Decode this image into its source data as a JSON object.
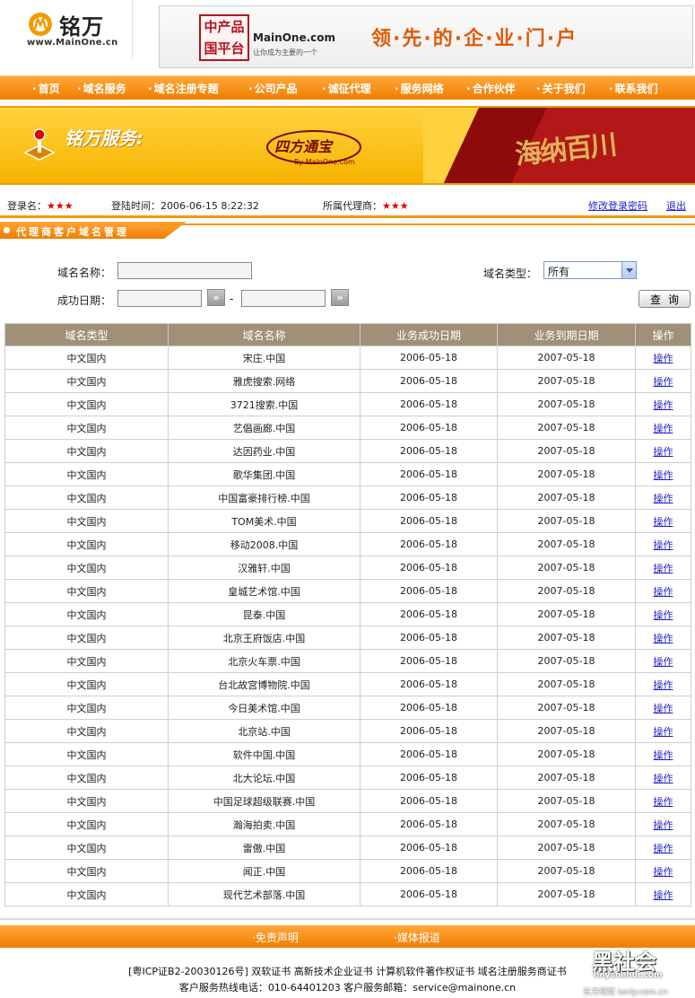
{
  "header": {
    "logo_text": "铭万",
    "logo_site": "www.MainOne.cn",
    "banner_seal": "中产品国平台",
    "banner_brand": "MainOne.com",
    "banner_sub": "让你成为主要的一个",
    "banner_slogan": "领·先·的·企·业·门·户"
  },
  "nav": {
    "items": [
      "首页",
      "域名服务",
      "域名注册专题",
      "公司产品",
      "诚征代理",
      "服务网络",
      "合作伙伴",
      "关于我们",
      "联系我们"
    ]
  },
  "service_banner": {
    "title": "铭万服务:",
    "product_name": "四方通宝",
    "product_byline": "By MainOne.com",
    "promo_text": "海纳百川"
  },
  "info": {
    "login_label": "登录名：",
    "login_value": "★★★",
    "time_label": "登陆时间：",
    "time_value": "2006-06-15 8:22:32",
    "agent_label": "所属代理商：",
    "agent_value": "★★★",
    "change_password": "修改登录密码",
    "logout": "退出"
  },
  "section": {
    "title": "代理商客户域名管理"
  },
  "search": {
    "name_label": "域名名称：",
    "name_value": "",
    "type_label": "域名类型：",
    "type_selected": "所有",
    "date_label": "成功日期：",
    "date_from": "",
    "date_to": "",
    "date_sep": "-",
    "picker_glyph": "»",
    "query_button": "查询"
  },
  "table": {
    "columns": [
      "域名类型",
      "域名名称",
      "业务成功日期",
      "业务到期日期",
      "操作"
    ],
    "rows": [
      {
        "type": "中文国内",
        "name": "宋庄.中国",
        "start": "2006-05-18",
        "end": "2007-05-18",
        "op": "操作"
      },
      {
        "type": "中文国内",
        "name": "雅虎搜索.网络",
        "start": "2006-05-18",
        "end": "2007-05-18",
        "op": "操作"
      },
      {
        "type": "中文国内",
        "name": "3721搜索.中国",
        "start": "2006-05-18",
        "end": "2007-05-18",
        "op": "操作"
      },
      {
        "type": "中文国内",
        "name": "艺倡画廊.中国",
        "start": "2006-05-18",
        "end": "2007-05-18",
        "op": "操作"
      },
      {
        "type": "中文国内",
        "name": "达因药业.中国",
        "start": "2006-05-18",
        "end": "2007-05-18",
        "op": "操作"
      },
      {
        "type": "中文国内",
        "name": "歌华集团.中国",
        "start": "2006-05-18",
        "end": "2007-05-18",
        "op": "操作"
      },
      {
        "type": "中文国内",
        "name": "中国富豪排行榜.中国",
        "start": "2006-05-18",
        "end": "2007-05-18",
        "op": "操作"
      },
      {
        "type": "中文国内",
        "name": "TOM美术.中国",
        "start": "2006-05-18",
        "end": "2007-05-18",
        "op": "操作"
      },
      {
        "type": "中文国内",
        "name": "移动2008.中国",
        "start": "2006-05-18",
        "end": "2007-05-18",
        "op": "操作"
      },
      {
        "type": "中文国内",
        "name": "汉雅轩.中国",
        "start": "2006-05-18",
        "end": "2007-05-18",
        "op": "操作"
      },
      {
        "type": "中文国内",
        "name": "皇城艺术馆.中国",
        "start": "2006-05-18",
        "end": "2007-05-18",
        "op": "操作"
      },
      {
        "type": "中文国内",
        "name": "昆泰.中国",
        "start": "2006-05-18",
        "end": "2007-05-18",
        "op": "操作"
      },
      {
        "type": "中文国内",
        "name": "北京王府饭店.中国",
        "start": "2006-05-18",
        "end": "2007-05-18",
        "op": "操作"
      },
      {
        "type": "中文国内",
        "name": "北京火车票.中国",
        "start": "2006-05-18",
        "end": "2007-05-18",
        "op": "操作"
      },
      {
        "type": "中文国内",
        "name": "台北故宫博物院.中国",
        "start": "2006-05-18",
        "end": "2007-05-18",
        "op": "操作"
      },
      {
        "type": "中文国内",
        "name": "今日美术馆.中国",
        "start": "2006-05-18",
        "end": "2007-05-18",
        "op": "操作"
      },
      {
        "type": "中文国内",
        "name": "北京站.中国",
        "start": "2006-05-18",
        "end": "2007-05-18",
        "op": "操作"
      },
      {
        "type": "中文国内",
        "name": "软件中国.中国",
        "start": "2006-05-18",
        "end": "2007-05-18",
        "op": "操作"
      },
      {
        "type": "中文国内",
        "name": "北大论坛.中国",
        "start": "2006-05-18",
        "end": "2007-05-18",
        "op": "操作"
      },
      {
        "type": "中文国内",
        "name": "中国足球超级联赛.中国",
        "start": "2006-05-18",
        "end": "2007-05-18",
        "op": "操作"
      },
      {
        "type": "中文国内",
        "name": "瀚海拍卖.中国",
        "start": "2006-05-18",
        "end": "2007-05-18",
        "op": "操作"
      },
      {
        "type": "中文国内",
        "name": "雷傲.中国",
        "start": "2006-05-18",
        "end": "2007-05-18",
        "op": "操作"
      },
      {
        "type": "中文国内",
        "name": "闻正.中国",
        "start": "2006-05-18",
        "end": "2007-05-18",
        "op": "操作"
      },
      {
        "type": "中文国内",
        "name": "现代艺术部落.中国",
        "start": "2006-05-18",
        "end": "2007-05-18",
        "op": "操作"
      }
    ]
  },
  "footer": {
    "links": [
      "免责声明",
      "媒体报道"
    ],
    "line1": "[粤ICP证B2-20030126号] 双软证书 高新技术企业证书 计算机软件著作权证书 域名注册服务商证书",
    "line2": "客户服务热线电话：010-64401203 客户服务邮箱：service@mainone.cn"
  },
  "watermark": {
    "text": "黑社会",
    "url": "heyshehui.com",
    "brand": "东方视觉 ionly.com.cn"
  },
  "colors": {
    "accent": "#f39a00",
    "table_header": "#a09078",
    "link": "#2222cc",
    "star": "#e00000"
  }
}
